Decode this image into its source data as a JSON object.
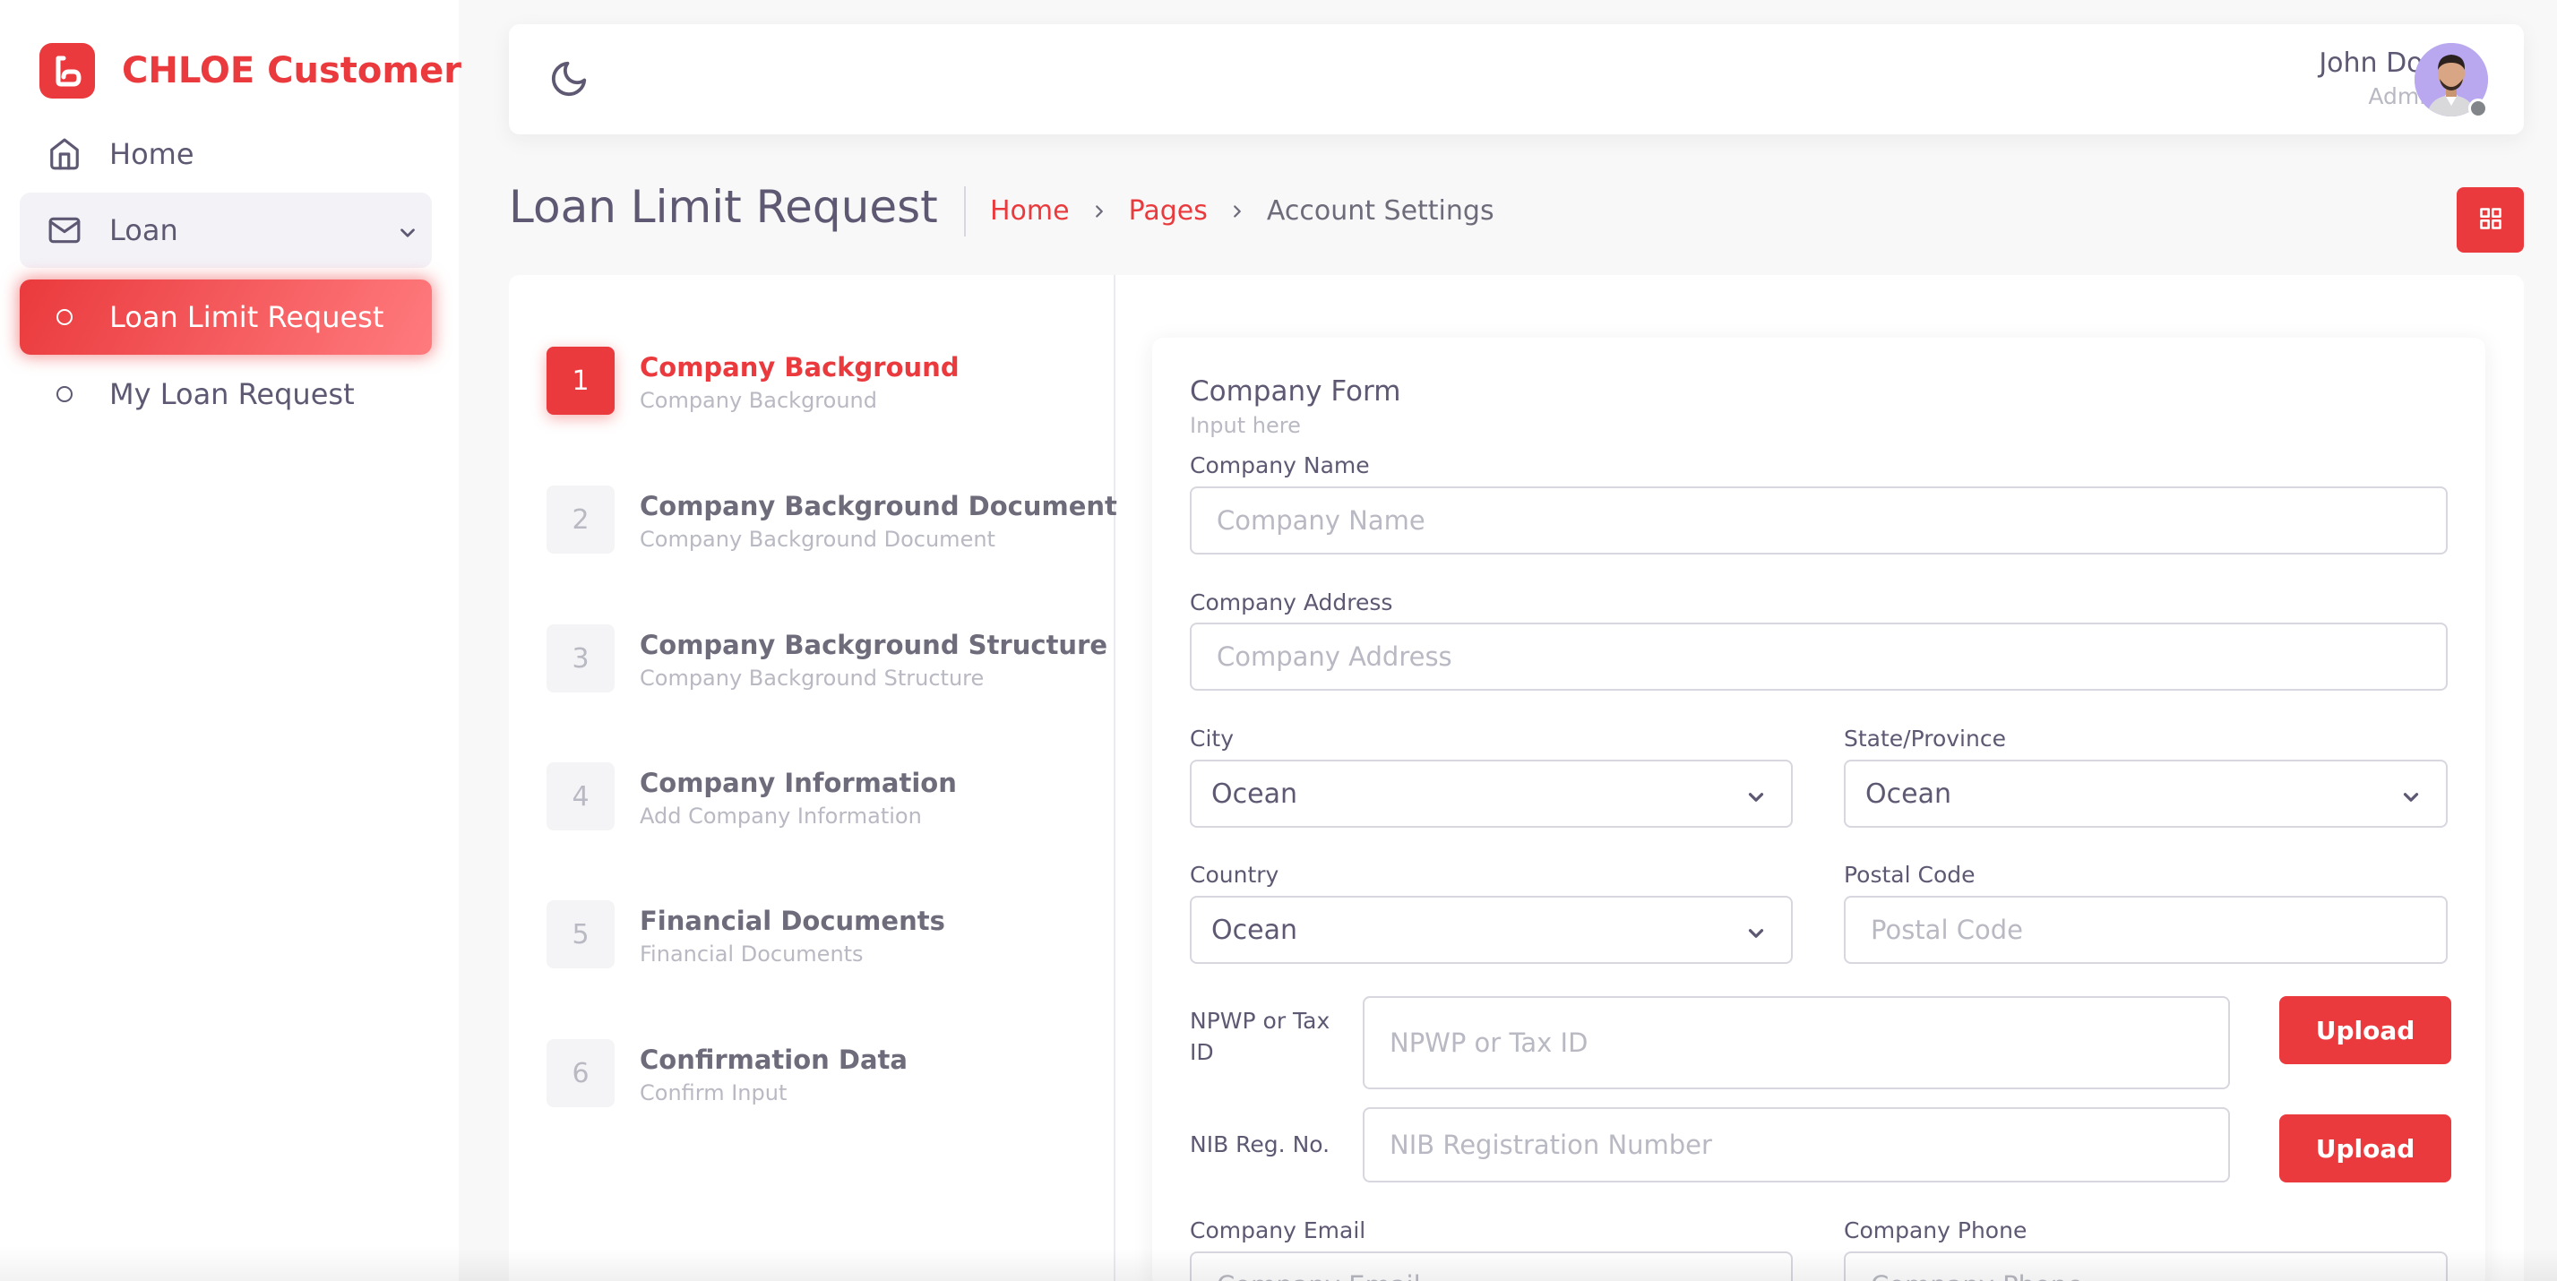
{
  "brand": {
    "name": "CHLOE Customer",
    "accent_color": "#ea3a3d"
  },
  "sidebar": {
    "items": [
      {
        "label": "Home",
        "icon": "home-icon"
      },
      {
        "label": "Loan",
        "icon": "mail-icon",
        "expanded": true
      },
      {
        "label": "Loan Limit Request",
        "icon": "circle-icon",
        "active": true
      },
      {
        "label": "My Loan Request",
        "icon": "circle-icon"
      }
    ]
  },
  "navbar": {
    "theme_icon": "moon-icon",
    "user": {
      "name": "John Doe",
      "role": "Admin"
    }
  },
  "page": {
    "title": "Loan Limit Request",
    "breadcrumb": [
      "Home",
      "Pages",
      "Account Settings"
    ]
  },
  "steps": [
    {
      "num": "1",
      "title": "Company Background",
      "subtitle": "Company Background",
      "active": true
    },
    {
      "num": "2",
      "title": "Company Background Document",
      "subtitle": "Company Background Document"
    },
    {
      "num": "3",
      "title": "Company Background Structure",
      "subtitle": "Company Background Structure"
    },
    {
      "num": "4",
      "title": "Company Information",
      "subtitle": "Add Company Information"
    },
    {
      "num": "5",
      "title": "Financial Documents",
      "subtitle": "Financial Documents"
    },
    {
      "num": "6",
      "title": "Confirmation Data",
      "subtitle": "Confirm Input"
    }
  ],
  "form": {
    "title": "Company Form",
    "subtitle": "Input here",
    "company_name": {
      "label": "Company Name",
      "placeholder": "Company Name",
      "value": ""
    },
    "company_address": {
      "label": "Company Address",
      "placeholder": "Company Address",
      "value": ""
    },
    "city": {
      "label": "City",
      "value": "Ocean"
    },
    "state": {
      "label": "State/Province",
      "value": "Ocean"
    },
    "country": {
      "label": "Country",
      "value": "Ocean"
    },
    "postal_code": {
      "label": "Postal Code",
      "placeholder": "Postal Code",
      "value": ""
    },
    "npwp": {
      "label": "NPWP or Tax ID",
      "placeholder": "NPWP or Tax ID",
      "value": "",
      "button": "Upload"
    },
    "nib": {
      "label": "NIB Reg. No.",
      "placeholder": "NIB Registration Number",
      "value": "",
      "button": "Upload"
    },
    "company_email": {
      "label": "Company Email",
      "placeholder": "Company Email",
      "value": ""
    },
    "company_phone": {
      "label": "Company Phone",
      "placeholder": "Company Phone",
      "value": ""
    }
  }
}
